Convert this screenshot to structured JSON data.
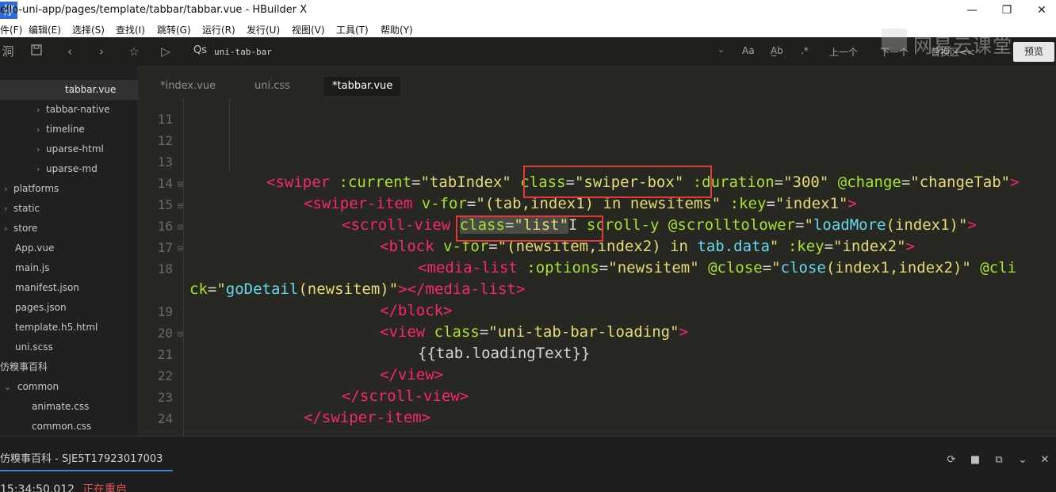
{
  "window": {
    "title": "ello-uni-app/pages/template/tabbar/tabbar.vue - HBuilder X",
    "app_icon_text": "停",
    "minimize": "—",
    "maximize": "❐",
    "close": "✕"
  },
  "menu": [
    "件(F)",
    "编辑(E)",
    "选择(S)",
    "查找(I)",
    "跳转(G)",
    "运行(R)",
    "发行(U)",
    "视图(V)",
    "工具(T)",
    "帮助(Y)"
  ],
  "toolbar": {
    "left_label": "洞",
    "search_value": "uni-tab-bar",
    "search_icon_text": "Qs",
    "case_label": "Aa",
    "word_label": "A̲b",
    "regex_label": ".*",
    "prev_label": "上一个",
    "next_label": "下一个",
    "scope_label": "替换区<<",
    "preview_label": "预览"
  },
  "watermark": "网易云课堂",
  "sidebar": {
    "items": [
      {
        "label": "tabbar.vue",
        "active": true
      },
      {
        "label": "tabbar-native",
        "chevron": "›"
      },
      {
        "label": "timeline",
        "chevron": "›"
      },
      {
        "label": "uparse-html",
        "chevron": "›"
      },
      {
        "label": "uparse-md",
        "chevron": "›"
      },
      {
        "label": "platforms",
        "chevron": "›"
      },
      {
        "label": "static",
        "chevron": "›"
      },
      {
        "label": "store",
        "chevron": "›"
      },
      {
        "label": "App.vue"
      },
      {
        "label": "main.js"
      },
      {
        "label": "manifest.json"
      },
      {
        "label": "pages.json"
      },
      {
        "label": "template.h5.html"
      },
      {
        "label": "uni.scss"
      },
      {
        "label": "仿糗事百科"
      },
      {
        "label": "common",
        "chevron": "⌄"
      },
      {
        "label": "animate.css"
      },
      {
        "label": "common.css"
      }
    ]
  },
  "tabs": [
    "*index.vue",
    "uni.css",
    "*tabbar.vue"
  ],
  "line_numbers": [
    "11",
    "12",
    "13",
    "14",
    "15",
    "16",
    "17",
    "18",
    "19",
    "20",
    "21",
    "22",
    "23",
    "24"
  ],
  "code": {
    "l14": {
      "tag": "<swiper",
      "a1": " :current",
      "eq1": "=",
      "v1": "\"tabIndex\"",
      "sp": " ",
      "a2": "class",
      "eq2": "=",
      "v2": "\"swiper-box\"",
      "a3": " :duration",
      "eq3": "=",
      "v3": "\"300\"",
      "a4": " @change",
      "eq4": "=",
      "v4": "\"changeTab\"",
      "end": ">"
    },
    "l15": {
      "tag": "<swiper-item",
      "a1": " v-for",
      "eq1": "=",
      "v1": "\"(tab,index1) in newsitems\"",
      "a2": " :key",
      "eq2": "=",
      "v2": "\"index1\"",
      "end": ">"
    },
    "l16": {
      "tag": "<scroll-view",
      "sp": " ",
      "a1": "class",
      "eq1": "=",
      "v1": "\"list\"",
      "cursor": "I",
      "a2": " scroll-y",
      "a3": " @scrolltolower",
      "eq3": "=",
      "v3a": "\"",
      "fn": "loadMore",
      "v3b": "(index1)\"",
      "end": ">"
    },
    "l17": {
      "tag": "<block",
      "a1": " v-for",
      "eq1": "=",
      "v1": "\"(newsitem,index2) in ",
      "v1b": "tab.data",
      "v1c": "\"",
      "a2": " :key",
      "eq2": "=",
      "v2": "\"index2\"",
      "end": ">"
    },
    "l18": {
      "tag": "<media-list",
      "a1": " :options",
      "eq1": "=",
      "v1": "\"newsitem\"",
      "a2": " @close",
      "eq2": "=",
      "v2a": "\"",
      "fn": "close",
      "v2b": "(index1,index2)\"",
      "a3": " @cli"
    },
    "l18b": {
      "a": "ck",
      "eq": "=",
      "va": "\"",
      "fn": "goDetail",
      "vb": "(newsitem)\"",
      "end": "></media-list>"
    },
    "l19": {
      "tag": "</block>"
    },
    "l20": {
      "tag": "<view",
      "a1": " class",
      "eq1": "=",
      "v1": "\"uni-tab-bar-loading\"",
      "end": ">"
    },
    "l21": {
      "text": "{{tab.loadingText}}"
    },
    "l22": {
      "tag": "</view>"
    },
    "l23": {
      "tag": "</scroll-view>"
    },
    "l24": {
      "tag": "</swiper-item>"
    }
  },
  "panel": {
    "tab_label": "仿糗事百科 - SJE5T17923017003",
    "console_time": "15:34:50.012",
    "console_status": "正在重启"
  },
  "colors": {
    "editor_bg": "#272822",
    "tag": "#f92672",
    "attr": "#a6e22e",
    "string": "#e6db74",
    "function": "#66d9ef",
    "highlight_box": "#e53935",
    "accent": "#3b7fd9"
  }
}
